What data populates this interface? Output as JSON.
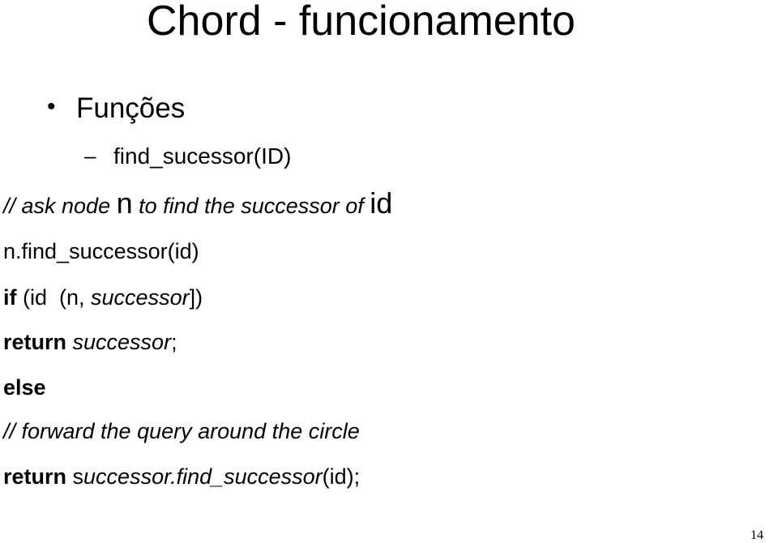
{
  "slide": {
    "title": "Chord - funcionamento",
    "bullet": {
      "marker": "•",
      "text": "Funções",
      "sub": {
        "marker": "–",
        "text": "find_sucessor(ID)"
      }
    },
    "code": {
      "line1": {
        "comment": "// ask node ",
        "n": "n",
        "rest": " to find the successor of ",
        "id": "id"
      },
      "line2": "n.find_successor(id)",
      "line3": {
        "kw": "if",
        "pre": " (id  (n, ",
        "it": "successor",
        "post": "])"
      },
      "line4": {
        "kw": "return",
        "it": " successor",
        "post": ";"
      },
      "line5": {
        "kw": "else"
      },
      "line6": "// forward the query around the circle",
      "line7": {
        "kw": "return",
        "s": " s",
        "it": "uccessor.find_successor",
        "post": "(id);"
      }
    },
    "page_number": "14"
  }
}
